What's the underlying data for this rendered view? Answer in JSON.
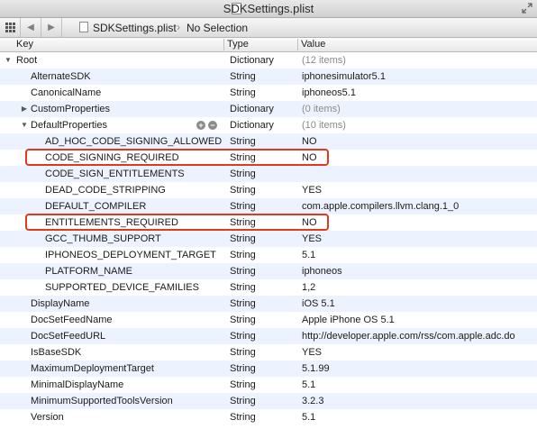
{
  "window": {
    "title": "SDKSettings.plist"
  },
  "jumpbar": {
    "file": "SDKSettings.plist",
    "separator": "›",
    "selection": "No Selection"
  },
  "columns": {
    "key": "Key",
    "type": "Type",
    "value": "Value"
  },
  "rows": [
    {
      "key": "Root",
      "type": "Dictionary",
      "value": "(12 items)",
      "depth": 0,
      "toggle": "open",
      "value_gray": true
    },
    {
      "key": "AlternateSDK",
      "type": "String",
      "value": "iphonesimulator5.1",
      "depth": 1
    },
    {
      "key": "CanonicalName",
      "type": "String",
      "value": "iphoneos5.1",
      "depth": 1
    },
    {
      "key": "CustomProperties",
      "type": "Dictionary",
      "value": "(0 items)",
      "depth": 1,
      "toggle": "closed",
      "value_gray": true
    },
    {
      "key": "DefaultProperties",
      "type": "Dictionary",
      "value": "(10 items)",
      "depth": 1,
      "toggle": "open",
      "value_gray": true,
      "row_buttons": true
    },
    {
      "key": "AD_HOC_CODE_SIGNING_ALLOWED",
      "type": "String",
      "value": "NO",
      "depth": 2
    },
    {
      "key": "CODE_SIGNING_REQUIRED",
      "type": "String",
      "value": "NO",
      "depth": 2,
      "highlight": true
    },
    {
      "key": "CODE_SIGN_ENTITLEMENTS",
      "type": "String",
      "value": "",
      "depth": 2
    },
    {
      "key": "DEAD_CODE_STRIPPING",
      "type": "String",
      "value": "YES",
      "depth": 2
    },
    {
      "key": "DEFAULT_COMPILER",
      "type": "String",
      "value": "com.apple.compilers.llvm.clang.1_0",
      "depth": 2
    },
    {
      "key": "ENTITLEMENTS_REQUIRED",
      "type": "String",
      "value": "NO",
      "depth": 2,
      "highlight": true
    },
    {
      "key": "GCC_THUMB_SUPPORT",
      "type": "String",
      "value": "YES",
      "depth": 2
    },
    {
      "key": "IPHONEOS_DEPLOYMENT_TARGET",
      "type": "String",
      "value": "5.1",
      "depth": 2
    },
    {
      "key": "PLATFORM_NAME",
      "type": "String",
      "value": "iphoneos",
      "depth": 2
    },
    {
      "key": "SUPPORTED_DEVICE_FAMILIES",
      "type": "String",
      "value": "1,2",
      "depth": 2
    },
    {
      "key": "DisplayName",
      "type": "String",
      "value": "iOS 5.1",
      "depth": 1
    },
    {
      "key": "DocSetFeedName",
      "type": "String",
      "value": "Apple iPhone OS 5.1",
      "depth": 1
    },
    {
      "key": "DocSetFeedURL",
      "type": "String",
      "value": "http://developer.apple.com/rss/com.apple.adc.do",
      "depth": 1
    },
    {
      "key": "IsBaseSDK",
      "type": "String",
      "value": "YES",
      "depth": 1
    },
    {
      "key": "MaximumDeploymentTarget",
      "type": "String",
      "value": "5.1.99",
      "depth": 1
    },
    {
      "key": "MinimalDisplayName",
      "type": "String",
      "value": "5.1",
      "depth": 1
    },
    {
      "key": "MinimumSupportedToolsVersion",
      "type": "String",
      "value": "3.2.3",
      "depth": 1
    },
    {
      "key": "Version",
      "type": "String",
      "value": "5.1",
      "depth": 1
    }
  ],
  "icons": {
    "grid": "grid-icon",
    "back": "chevron-left-icon",
    "forward": "chevron-right-icon",
    "document": "plist-file-icon",
    "fullscreen": "fullscreen-icon",
    "add": "add-icon",
    "remove": "remove-icon"
  },
  "colors": {
    "highlight": "#e0391b",
    "alt_row": "#edf3fe"
  }
}
